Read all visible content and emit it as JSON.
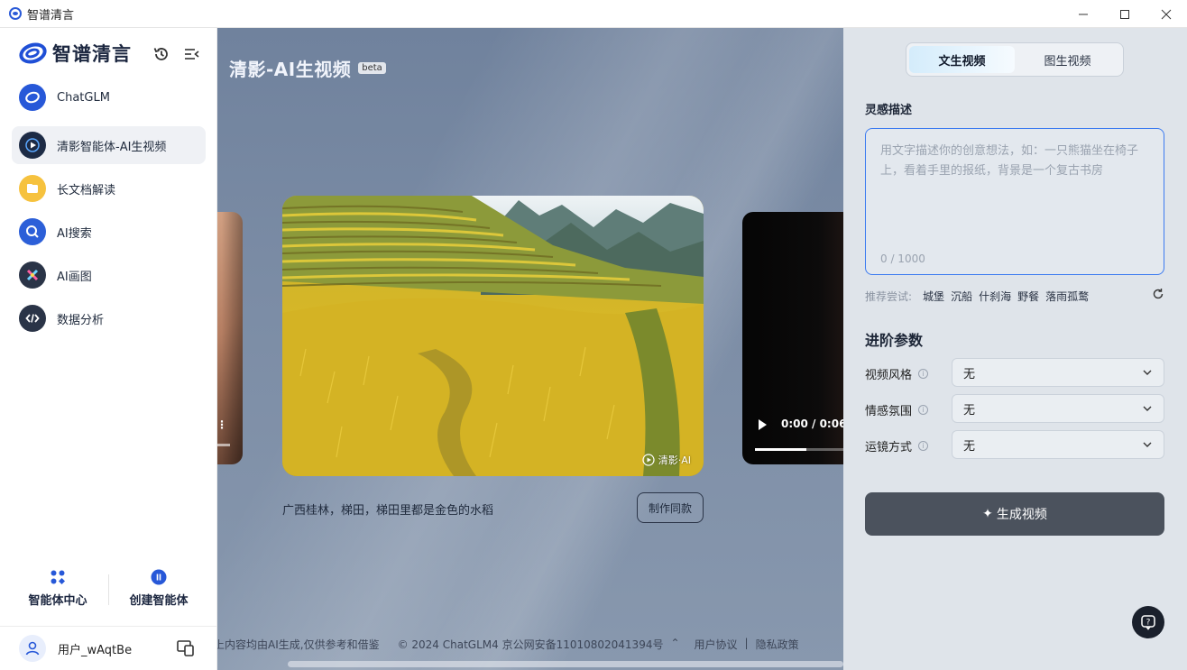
{
  "window": {
    "title": "智谱清言"
  },
  "sidebar": {
    "brand": "智谱清言",
    "items": [
      {
        "label": "ChatGLM",
        "icon": "chatglm-icon",
        "active": false
      },
      {
        "label": "清影智能体-AI生视频",
        "icon": "play-icon",
        "active": true
      },
      {
        "label": "长文档解读",
        "icon": "folder-icon",
        "active": false
      },
      {
        "label": "AI搜索",
        "icon": "search-icon",
        "active": false
      },
      {
        "label": "AI画图",
        "icon": "paint-icon",
        "active": false
      },
      {
        "label": "数据分析",
        "icon": "code-icon",
        "active": false
      }
    ],
    "agent_center": "智能体中心",
    "create_agent": "创建智能体",
    "username": "用户_wAqtBe"
  },
  "main": {
    "title": "清影-AI生视频",
    "badge": "beta",
    "video_caption": "广西桂林，梯田，梯田里都是金色的水稻",
    "make_same": "制作同款",
    "watermark": "清影·AI",
    "right_card_time": "0:00 / 0:06",
    "right_card_progress": 0.45,
    "footer": {
      "disclaimer": "上内容均由AI生成,仅供参考和借鉴",
      "copyright": "© 2024 ChatGLM4 京公网安备11010802041394号",
      "user_agreement": "用户协议",
      "separator": "|",
      "privacy": "隐私政策"
    }
  },
  "panel": {
    "tabs": [
      "文生视频",
      "图生视频"
    ],
    "active_tab": 0,
    "inspiration_label": "灵感描述",
    "textarea_placeholder": "用文字描述你的创意想法，如：一只熊猫坐在椅子上，看着手里的报纸，背景是一个复古书房",
    "char_count": "0 / 1000",
    "suggest_label": "推荐尝试:",
    "suggestions": [
      "城堡",
      "沉船",
      "什刹海",
      "野餐",
      "落雨孤鹜"
    ],
    "advanced_title": "进阶参数",
    "params": [
      {
        "label": "视频风格",
        "value": "无"
      },
      {
        "label": "情感氛围",
        "value": "无"
      },
      {
        "label": "运镜方式",
        "value": "无"
      }
    ],
    "generate_button": "生成视频",
    "accent_color": "#3c7bf0"
  }
}
